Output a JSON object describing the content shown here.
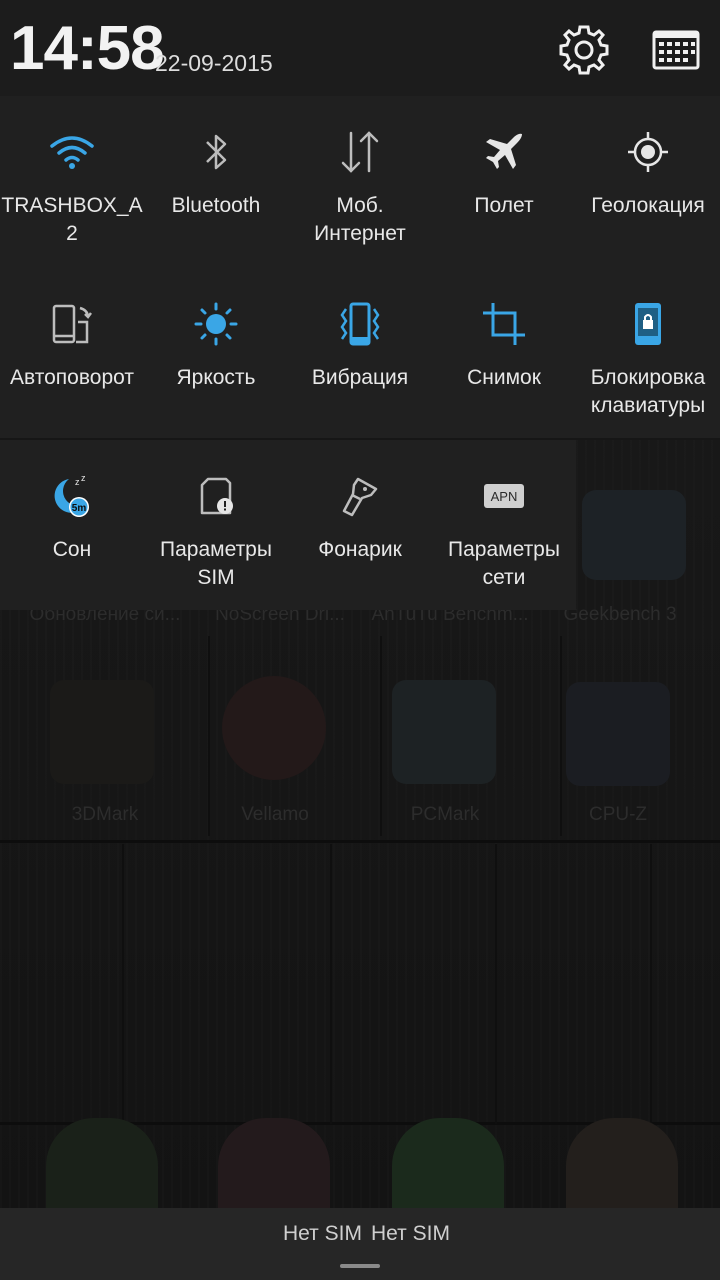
{
  "header": {
    "time": "14:58",
    "date": "22-09-2015",
    "settings_icon": "gear-icon",
    "edit_icon": "grid-edit-icon"
  },
  "colors": {
    "accent": "#3aa6e6",
    "tile_bg": "#202020",
    "header_bg": "#1c1c1c"
  },
  "tiles": [
    [
      {
        "label": "TRASHBOX_A\n2",
        "icon": "wifi-icon",
        "active": true
      },
      {
        "label": "Bluetooth",
        "icon": "bluetooth-icon",
        "active": false
      },
      {
        "label": "Моб. Интернет",
        "icon": "mobile-data-icon",
        "active": false
      },
      {
        "label": "Полет",
        "icon": "airplane-icon",
        "active": false
      },
      {
        "label": "Геолокация",
        "icon": "location-icon",
        "active": false
      }
    ],
    [
      {
        "label": "Автоповорот",
        "icon": "autorotate-icon",
        "active": false
      },
      {
        "label": "Яркость",
        "icon": "brightness-icon",
        "active": true
      },
      {
        "label": "Вибрация",
        "icon": "vibration-icon",
        "active": true
      },
      {
        "label": "Снимок",
        "icon": "crop-icon",
        "active": true
      },
      {
        "label": "Блокировка клавиатуры",
        "icon": "keyboard-lock-icon",
        "active": true
      }
    ],
    [
      {
        "label": "Сон",
        "icon": "sleep-icon",
        "active": true,
        "badge": "5m"
      },
      {
        "label": "Параметры SIM",
        "icon": "sim-settings-icon",
        "active": false
      },
      {
        "label": "Фонарик",
        "icon": "flashlight-icon",
        "active": false
      },
      {
        "label": "Параметры сети",
        "icon": "apn-icon",
        "active": false,
        "badge": "APN"
      }
    ]
  ],
  "homescreen": {
    "apps_row1": [
      "Обновление си...",
      "NoScreen Dri...",
      "AnTuTu Benchm...",
      "Geekbench 3"
    ],
    "apps_row2": [
      "3DMark",
      "Vellamo",
      "PCMark",
      "CPU-Z"
    ]
  },
  "simbar": {
    "sim1": "Нет SIM",
    "sim2": "Нет SIM"
  }
}
